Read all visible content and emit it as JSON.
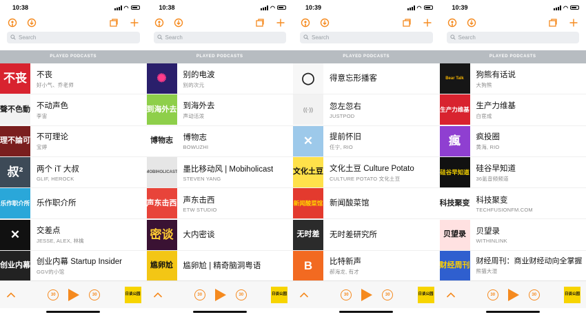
{
  "app": {
    "search_placeholder": "Search",
    "section_label": "PLAYED PODCASTS",
    "skip_back_label": "30",
    "skip_fwd_label": "30",
    "now_playing_art_label": "日谈公园",
    "accent_color": "#f58a1f"
  },
  "screens": [
    {
      "time": "10:38",
      "podcasts": [
        {
          "title": "不丧",
          "subtitle": "好小气、乔老师",
          "art_text": "不丧",
          "art_bg": "#d8232f",
          "art_fg": "#ffffff"
        },
        {
          "title": "不动声色",
          "subtitle": "李宙",
          "art_text": "聲不色動",
          "art_bg": "#f2f2f2",
          "art_fg": "#222222"
        },
        {
          "title": "不可理论",
          "subtitle": "宝婷",
          "art_text": "理不論可",
          "art_bg": "#7a1e1e",
          "art_fg": "#ffffff"
        },
        {
          "title": "两个 iT 大叔",
          "subtitle": "GLIF, HEROCK",
          "art_text": "叔²",
          "art_bg": "#3d4a57",
          "art_fg": "#ffffff"
        },
        {
          "title": "乐作职介所",
          "subtitle": "",
          "art_text": "乐作职介所",
          "art_bg": "#2aa7d9",
          "art_fg": "#ffffff"
        },
        {
          "title": "交差点",
          "subtitle": "JESSE, ALEX, 林檎",
          "art_text": "✕",
          "art_bg": "#111111",
          "art_fg": "#ffffff"
        },
        {
          "title": "创业内幕 Startup Insider",
          "subtitle": "GGV的小馆",
          "art_text": "创业内幕",
          "art_bg": "#222222",
          "art_fg": "#ffffff"
        }
      ]
    },
    {
      "time": "10:38",
      "podcasts": [
        {
          "title": "别的电波",
          "subtitle": "别的次元",
          "art_text": "✺",
          "art_bg": "#2a1f6b",
          "art_fg": "#ff3c8a"
        },
        {
          "title": "到海外去",
          "subtitle": "声动活泼",
          "art_text": "到海外去",
          "art_bg": "#8ecf4a",
          "art_fg": "#ffffff"
        },
        {
          "title": "博物志",
          "subtitle": "BOWUZHI",
          "art_text": "博物志",
          "art_bg": "#ffffff",
          "art_fg": "#222222"
        },
        {
          "title": "墨比移动风 | Mobiholicast",
          "subtitle": "STEVEN YANG",
          "art_text": "MOBIHOLICAST",
          "art_bg": "#e6e6e6",
          "art_fg": "#555555"
        },
        {
          "title": "声东击西",
          "subtitle": "ETW STUDIO",
          "art_text": "声东击西",
          "art_bg": "#e8443a",
          "art_fg": "#ffffff"
        },
        {
          "title": "大内密谈",
          "subtitle": "",
          "art_text": "密谈",
          "art_bg": "#3a1233",
          "art_fg": "#ffcc33"
        },
        {
          "title": "尴卵尬 | 精奇脑洞粤语",
          "subtitle": "",
          "art_text": "尴卵尬",
          "art_bg": "#f3c615",
          "art_fg": "#111111"
        }
      ]
    },
    {
      "time": "10:39",
      "podcasts": [
        {
          "title": "得意忘形播客",
          "subtitle": "",
          "art_text": "◯",
          "art_bg": "#f7f7f7",
          "art_fg": "#222222"
        },
        {
          "title": "忽左忽右",
          "subtitle": "JUSTPOD",
          "art_text": "((·))",
          "art_bg": "#f2f2f2",
          "art_fg": "#999999"
        },
        {
          "title": "提前怀旧",
          "subtitle": "任宁, RIO",
          "art_text": "✕",
          "art_bg": "#9dc9ea",
          "art_fg": "#ffffff"
        },
        {
          "title": "文化土豆 Culture Potato",
          "subtitle": "CULTURE POTATO 文化土豆",
          "art_text": "文化土豆",
          "art_bg": "#ffe14a",
          "art_fg": "#111111"
        },
        {
          "title": "新闻酸菜馆",
          "subtitle": "",
          "art_text": "新闻酸菜馆",
          "art_bg": "#e33a2e",
          "art_fg": "#ffd000"
        },
        {
          "title": "无时差研究所",
          "subtitle": "",
          "art_text": "无时差",
          "art_bg": "#2b2b2b",
          "art_fg": "#ffffff"
        },
        {
          "title": "比特新声",
          "subtitle": "郝海龙, 有才",
          "art_text": "B",
          "art_bg": "#f26a21",
          "art_fg": "#ffffff"
        }
      ]
    },
    {
      "time": "10:39",
      "podcasts": [
        {
          "title": "狗熊有话说",
          "subtitle": "大狗熊",
          "art_text": "Bear Talk",
          "art_bg": "#161616",
          "art_fg": "#f5b400"
        },
        {
          "title": "生产力维基",
          "subtitle": "白宦成",
          "art_text": "生产力维基",
          "art_bg": "#d8232f",
          "art_fg": "#ffffff"
        },
        {
          "title": "疯投圈",
          "subtitle": "黄海, RIO",
          "art_text": "瘋",
          "art_bg": "#8f3fd1",
          "art_fg": "#ffffff"
        },
        {
          "title": "硅谷早知道",
          "subtitle": "36氪音频频道",
          "art_text": "硅谷早知道",
          "art_bg": "#111111",
          "art_fg": "#f7d400"
        },
        {
          "title": "科技聚变",
          "subtitle": "TECHFUSIONFM.COM",
          "art_text": "科技聚变",
          "art_bg": "#ffffff",
          "art_fg": "#222222"
        },
        {
          "title": "贝望录",
          "subtitle": "WITHINLINK",
          "art_text": "贝望录",
          "art_bg": "#ffe1e1",
          "art_fg": "#111111"
        },
        {
          "title": "财经周刊：商业财经动向全掌握",
          "subtitle": "熊猫大湿",
          "art_text": "财经周刊",
          "art_bg": "#2f5fcf",
          "art_fg": "#ffd000"
        }
      ]
    }
  ]
}
